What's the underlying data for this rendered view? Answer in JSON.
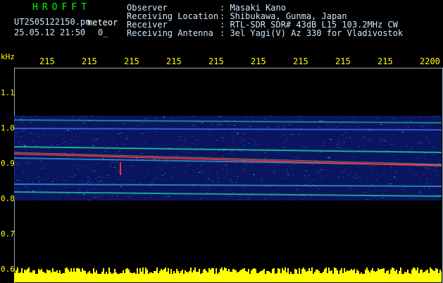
{
  "app": {
    "title": "HROFFT",
    "filename": "UT2505122150.pn",
    "mode_tag": "meteor",
    "datetime": "25.05.12 21:50",
    "counter": "0_"
  },
  "metadata": {
    "rows": [
      {
        "label": "Observer",
        "value": ": Masaki Kano"
      },
      {
        "label": "Receiving Location",
        "value": ": Shibukawa, Gunma, Japan"
      },
      {
        "label": "Receiver",
        "value": ": RTL-SDR SDR# 43dB L15 103.2MHz CW"
      },
      {
        "label": "Receiving Antenna",
        "value": ": 3el Yagi(V) Az 330 for Vladivostok"
      }
    ]
  },
  "y_axis": {
    "unit": "kHz",
    "ticks": [
      "1.1",
      "1.0",
      "0.9",
      "0.8",
      "0.7",
      "0.6"
    ]
  },
  "x_axis": {
    "ticks": [
      "215",
      "215",
      "215",
      "215",
      "215",
      "215",
      "215",
      "215",
      "215",
      "2200"
    ]
  },
  "colors": {
    "background": "#000000",
    "header_text": "#cfe9ff",
    "title_green": "#00ff00",
    "axis_yellow": "#ffff00",
    "signal_red": "#ff3030",
    "noise_blue": "#1e3cc8",
    "band_green": "#20e0a0",
    "amplitude_yellow": "#ffff00"
  }
}
